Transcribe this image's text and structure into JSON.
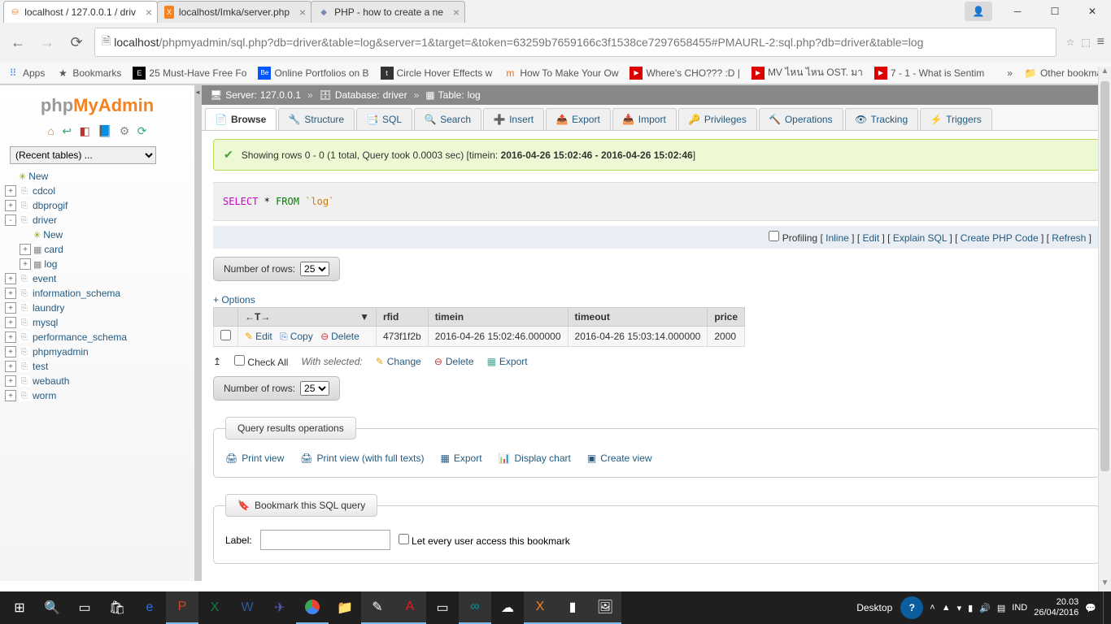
{
  "browser": {
    "tabs": [
      {
        "title": "localhost / 127.0.0.1 / driv",
        "active": true,
        "icon": "pma"
      },
      {
        "title": "localhost/Imka/server.php",
        "active": false,
        "icon": "xampp"
      },
      {
        "title": "PHP - how to create a ne",
        "active": false,
        "icon": "php"
      }
    ],
    "url_host": "localhost",
    "url_path": "/phpmyadmin/sql.php?db=driver&table=log&server=1&target=&token=63259b7659166c3f1538ce7297658455#PMAURL-2:sql.php?db=driver&table=log",
    "bookmarks": [
      {
        "label": "Apps",
        "icon": "grid"
      },
      {
        "label": "Bookmarks",
        "icon": "star"
      },
      {
        "label": "25 Must-Have Free Fo",
        "icon": "E"
      },
      {
        "label": "Online Portfolios on B",
        "icon": "Be"
      },
      {
        "label": "Circle Hover Effects w",
        "icon": "t"
      },
      {
        "label": "How To Make Your Ow",
        "icon": "m"
      },
      {
        "label": "Where's CHO??? :D |",
        "icon": "red"
      },
      {
        "label": "MV ไหน ไหน OST. มา",
        "icon": "yt"
      },
      {
        "label": "7 - 1 - What is Sentim",
        "icon": "yt"
      }
    ],
    "other_bookmarks": "Other bookmarks"
  },
  "sidebar": {
    "recent_placeholder": "(Recent tables) ...",
    "tree": [
      {
        "label": "New",
        "type": "new",
        "indent": 0,
        "toggle": null,
        "icon": "new"
      },
      {
        "label": "cdcol",
        "type": "db",
        "indent": 0,
        "toggle": "+"
      },
      {
        "label": "dbprogif",
        "type": "db",
        "indent": 0,
        "toggle": "+"
      },
      {
        "label": "driver",
        "type": "db",
        "indent": 0,
        "toggle": "-"
      },
      {
        "label": "New",
        "type": "new",
        "indent": 1,
        "toggle": null,
        "icon": "new"
      },
      {
        "label": "card",
        "type": "table",
        "indent": 1,
        "toggle": "+"
      },
      {
        "label": "log",
        "type": "table",
        "indent": 1,
        "toggle": "+"
      },
      {
        "label": "event",
        "type": "db",
        "indent": 0,
        "toggle": "+"
      },
      {
        "label": "information_schema",
        "type": "db",
        "indent": 0,
        "toggle": "+"
      },
      {
        "label": "laundry",
        "type": "db",
        "indent": 0,
        "toggle": "+"
      },
      {
        "label": "mysql",
        "type": "db",
        "indent": 0,
        "toggle": "+"
      },
      {
        "label": "performance_schema",
        "type": "db",
        "indent": 0,
        "toggle": "+"
      },
      {
        "label": "phpmyadmin",
        "type": "db",
        "indent": 0,
        "toggle": "+"
      },
      {
        "label": "test",
        "type": "db",
        "indent": 0,
        "toggle": "+"
      },
      {
        "label": "webauth",
        "type": "db",
        "indent": 0,
        "toggle": "+"
      },
      {
        "label": "worm",
        "type": "db",
        "indent": 0,
        "toggle": "+"
      }
    ]
  },
  "breadcrumb": {
    "server_label": "Server:",
    "server_value": "127.0.0.1",
    "db_label": "Database:",
    "db_value": "driver",
    "table_label": "Table:",
    "table_value": "log"
  },
  "navtabs": [
    {
      "label": "Browse",
      "icon": "📄",
      "active": true
    },
    {
      "label": "Structure",
      "icon": "🔧",
      "active": false
    },
    {
      "label": "SQL",
      "icon": "📑",
      "active": false
    },
    {
      "label": "Search",
      "icon": "🔍",
      "active": false
    },
    {
      "label": "Insert",
      "icon": "➕",
      "active": false
    },
    {
      "label": "Export",
      "icon": "📤",
      "active": false
    },
    {
      "label": "Import",
      "icon": "📥",
      "active": false
    },
    {
      "label": "Privileges",
      "icon": "🔑",
      "active": false
    },
    {
      "label": "Operations",
      "icon": "🔨",
      "active": false
    },
    {
      "label": "Tracking",
      "icon": "👁",
      "active": false
    },
    {
      "label": "Triggers",
      "icon": "⚡",
      "active": false
    }
  ],
  "success": {
    "text_pre": "Showing rows 0 - 0 (1 total, Query took 0.0003 sec) [timein: ",
    "bold": "2016-04-26 15:02:46 - 2016-04-26 15:02:46",
    "text_post": "]"
  },
  "sql": {
    "select": "SELECT",
    "star": "*",
    "from": "FROM",
    "table": "`log`"
  },
  "actions": {
    "profiling": "Profiling",
    "inline": "Inline",
    "edit": "Edit",
    "explain": "Explain SQL",
    "php": "Create PHP Code",
    "refresh": "Refresh"
  },
  "rows_label": "Number of rows:",
  "rows_value": "25",
  "options_label": "+ Options",
  "table": {
    "headers": [
      "rfid",
      "timein",
      "timeout",
      "price"
    ],
    "rows": [
      {
        "rfid": "473f1f2b",
        "timein": "2016-04-26 15:02:46.000000",
        "timeout": "2016-04-26 15:03:14.000000",
        "price": "2000"
      }
    ],
    "edit": "Edit",
    "copy": "Copy",
    "delete": "Delete"
  },
  "with_selected": {
    "check_all": "Check All",
    "label": "With selected:",
    "change": "Change",
    "delete": "Delete",
    "export": "Export"
  },
  "query_ops": {
    "legend": "Query results operations",
    "print": "Print view",
    "print_full": "Print view (with full texts)",
    "export": "Export",
    "chart": "Display chart",
    "create_view": "Create view"
  },
  "bookmark": {
    "legend": "Bookmark this SQL query",
    "label": "Label:",
    "checkbox": "Let every user access this bookmark"
  },
  "taskbar": {
    "desktop": "Desktop",
    "lang": "IND",
    "time": "20.03",
    "date": "26/04/2016"
  }
}
